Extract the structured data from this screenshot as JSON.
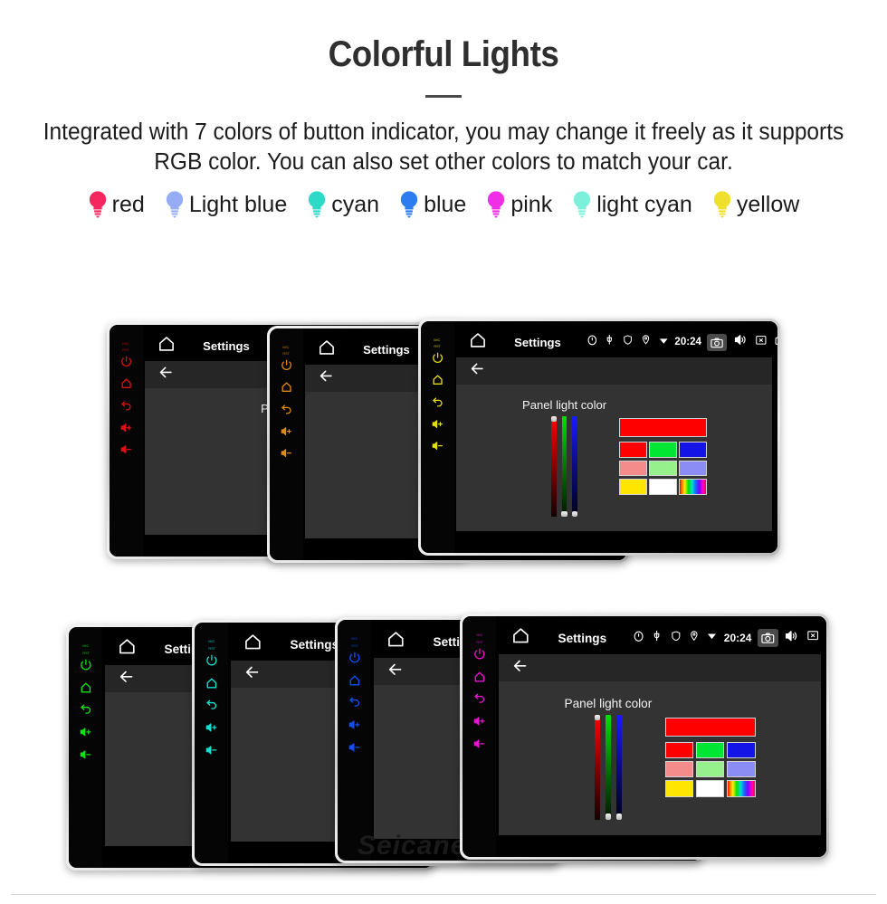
{
  "header": {
    "title": "Colorful Lights",
    "subtitle": "Integrated with 7 colors of button indicator, you may change it freely as it supports RGB color. You can also set other colors to match your car."
  },
  "legend": {
    "items": [
      {
        "label": "red",
        "color": "#f5275e",
        "icon": "lightbulb-icon"
      },
      {
        "label": "Light blue",
        "color": "#96adf5",
        "icon": "lightbulb-icon"
      },
      {
        "label": "cyan",
        "color": "#2ed9c8",
        "icon": "lightbulb-icon"
      },
      {
        "label": "blue",
        "color": "#2e7df0",
        "icon": "lightbulb-icon"
      },
      {
        "label": "pink",
        "color": "#f02ee8",
        "icon": "lightbulb-icon"
      },
      {
        "label": "light cyan",
        "color": "#7df0dc",
        "icon": "lightbulb-icon"
      },
      {
        "label": "yellow",
        "color": "#f0e02e",
        "icon": "lightbulb-icon"
      }
    ]
  },
  "device_ui": {
    "statusbar": {
      "home_icon": "home-icon",
      "title": "Settings",
      "micro_icons": [
        "timer-icon",
        "usb-icon"
      ],
      "right_icons": [
        "shield-icon",
        "location-pin-icon",
        "wifi-icon"
      ],
      "clock": "20:24",
      "nav_icons": [
        "camera-icon",
        "speaker-icon",
        "close-box-icon",
        "recent-apps-icon",
        "back-arrow-icon"
      ]
    },
    "appbar": {
      "back_icon": "back-arrow-icon"
    },
    "content": {
      "slider_label": "Panel light color",
      "sliders": [
        {
          "name": "red-slider",
          "channel": "R",
          "value": 100
        },
        {
          "name": "green-slider",
          "channel": "G",
          "value": 0
        },
        {
          "name": "blue-slider",
          "channel": "B",
          "value": 0
        }
      ],
      "preview_color": "#ff0000",
      "swatches": [
        [
          "#ff0000",
          "#00e632",
          "#1414e6"
        ],
        [
          "#f58c8c",
          "#96f08c",
          "#8c8cf5"
        ],
        [
          "#ffe600",
          "#ffffff",
          "rainbow"
        ]
      ]
    },
    "bezel": {
      "labels": [
        "MIC",
        "RST"
      ],
      "keys": [
        "power-icon",
        "home-icon",
        "back-icon",
        "volume-up-icon",
        "volume-down-icon"
      ]
    }
  },
  "devices": {
    "top_row": [
      {
        "name": "device-red",
        "key_color": "#e01010"
      },
      {
        "name": "device-orange",
        "key_color": "#e08a10"
      },
      {
        "name": "device-yellow",
        "key_color": "#e8dc10"
      }
    ],
    "bottom_row": [
      {
        "name": "device-green",
        "key_color": "#14e014"
      },
      {
        "name": "device-cyan",
        "key_color": "#14e0d2"
      },
      {
        "name": "device-blue",
        "key_color": "#1450f0"
      },
      {
        "name": "device-magenta",
        "key_color": "#e814d2"
      }
    ]
  },
  "watermark": {
    "text": "Seicane"
  }
}
